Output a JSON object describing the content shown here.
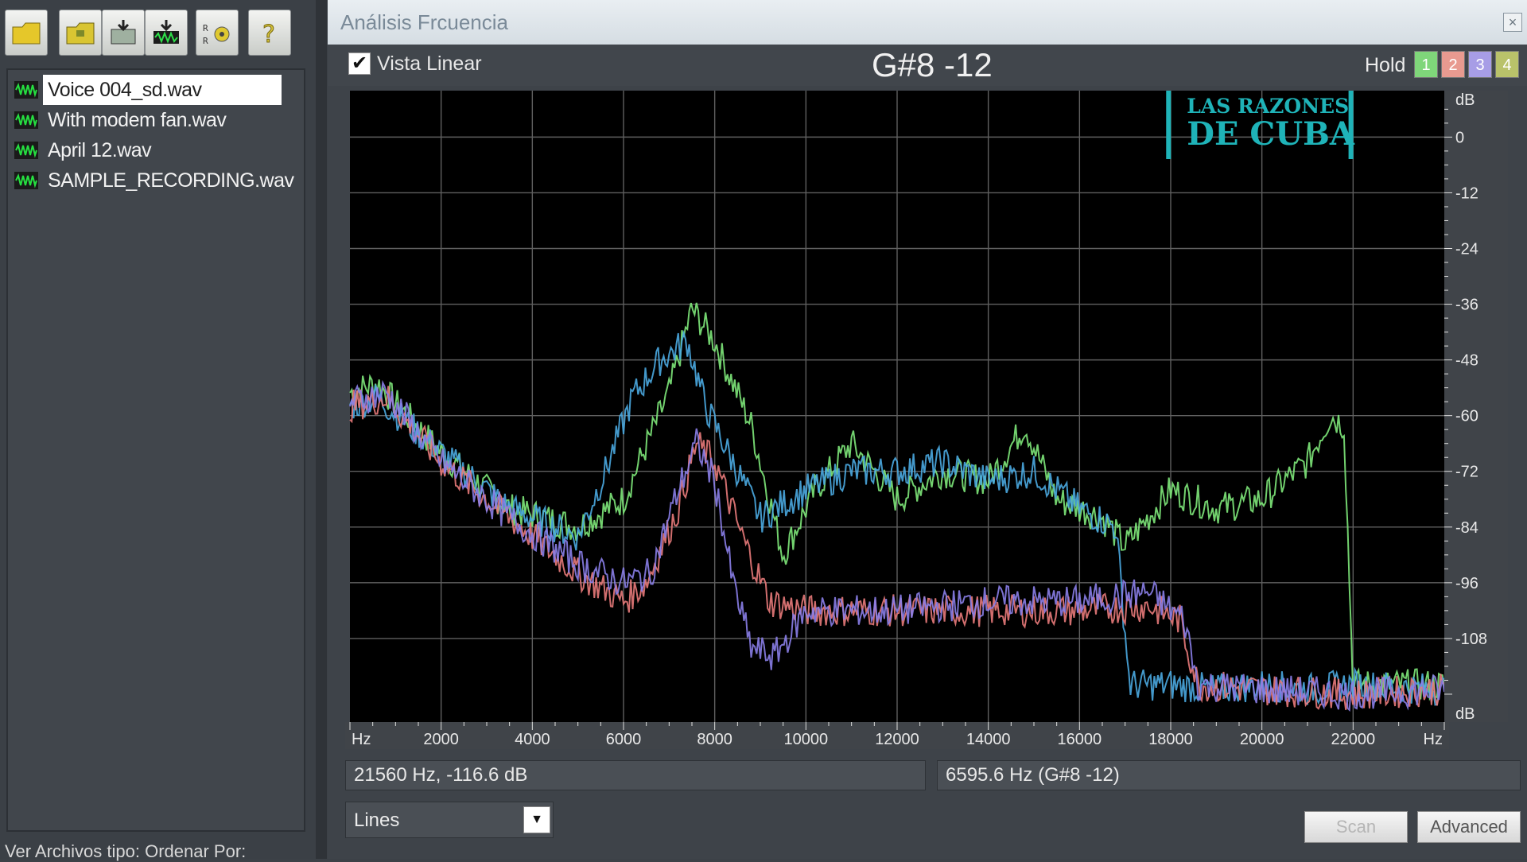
{
  "left_panel": {
    "files": [
      {
        "name": "Voice 004_sd.wav",
        "selected": true
      },
      {
        "name": "With modem fan.wav",
        "selected": false
      },
      {
        "name": "April 12.wav",
        "selected": false
      },
      {
        "name": "SAMPLE_RECORDING.wav",
        "selected": false
      }
    ],
    "bottom_label": "Ver Archivos tipo:  Ordenar Por:"
  },
  "window": {
    "title": "Análisis Frcuencia",
    "close_glyph": "×",
    "vista_linear_label": "Vista Linear",
    "vista_linear_checked": true,
    "note_display": "G#8 -12",
    "hold_label": "Hold",
    "hold_buttons": [
      {
        "label": "1",
        "color": "#7fd67a"
      },
      {
        "label": "2",
        "color": "#e89a90"
      },
      {
        "label": "3",
        "color": "#a79de6"
      },
      {
        "label": "4",
        "color": "#b9c26a"
      }
    ],
    "readout_left": "21560 Hz, -116.6 dB",
    "readout_right": "6595.6 Hz (G#8 -12)",
    "mode_select": "Lines",
    "scan_label": "Scan",
    "advanced_label": "Advanced"
  },
  "watermark": {
    "line1": "LAS RAZONES",
    "line2": "DE CUBA",
    "color": "#1fb3b8"
  },
  "chart_data": {
    "type": "line",
    "x_unit": "Hz",
    "y_unit": "dB",
    "xlim": [
      0,
      24000
    ],
    "ylim": [
      -126,
      10
    ],
    "x_ticks": [
      2000,
      4000,
      6000,
      8000,
      10000,
      12000,
      14000,
      16000,
      18000,
      20000,
      22000
    ],
    "y_ticks": [
      0,
      -12,
      -24,
      -36,
      -48,
      -60,
      -72,
      -84,
      -96,
      -108
    ],
    "grid": true,
    "series": [
      {
        "color": "#7ee87a",
        "x": [
          0,
          600,
          2000,
          3500,
          5000,
          6000,
          7000,
          7500,
          8000,
          8800,
          9500,
          10200,
          11000,
          12000,
          13000,
          14000,
          14800,
          15500,
          16500,
          17000,
          18000,
          19000,
          20000,
          21000,
          21500,
          21800,
          22000,
          24000
        ],
        "y": [
          -55,
          -53,
          -68,
          -80,
          -84,
          -78,
          -55,
          -37,
          -44,
          -62,
          -90,
          -76,
          -66,
          -78,
          -72,
          -74,
          -62,
          -78,
          -82,
          -88,
          -76,
          -80,
          -78,
          -70,
          -60,
          -62,
          -118,
          -118
        ]
      },
      {
        "color": "#4aa8e0",
        "x": [
          0,
          600,
          2000,
          3500,
          5000,
          5600,
          6200,
          6800,
          7400,
          7800,
          8500,
          9000,
          10000,
          11000,
          12000,
          13000,
          14000,
          15000,
          16000,
          16800,
          17100,
          18000,
          19000,
          20000,
          21000,
          22000,
          24000
        ],
        "y": [
          -58,
          -56,
          -68,
          -80,
          -86,
          -72,
          -56,
          -48,
          -44,
          -58,
          -72,
          -82,
          -76,
          -72,
          -72,
          -70,
          -74,
          -72,
          -80,
          -84,
          -118,
          -118,
          -119,
          -118,
          -119,
          -118,
          -119
        ]
      },
      {
        "color": "#e87a7a",
        "x": [
          0,
          800,
          2000,
          3500,
          5000,
          6000,
          6500,
          7200,
          7600,
          8000,
          8600,
          9200,
          10000,
          12000,
          14000,
          16000,
          17500,
          18200,
          18600,
          20000,
          22000,
          24000
        ],
        "y": [
          -58,
          -56,
          -70,
          -82,
          -94,
          -100,
          -96,
          -80,
          -66,
          -70,
          -86,
          -100,
          -102,
          -102,
          -102,
          -102,
          -101,
          -104,
          -118,
          -119,
          -120,
          -119
        ]
      },
      {
        "color": "#8a7ee8",
        "x": [
          0,
          800,
          2000,
          3500,
          5000,
          6000,
          6600,
          7200,
          7600,
          8000,
          8400,
          8800,
          9300,
          10000,
          12000,
          14000,
          16000,
          17500,
          18300,
          18600,
          20000,
          22000,
          24000
        ],
        "y": [
          -57,
          -55,
          -70,
          -82,
          -92,
          -96,
          -94,
          -76,
          -66,
          -74,
          -96,
          -110,
          -112,
          -102,
          -102,
          -100,
          -100,
          -98,
          -104,
          -118,
          -119,
          -120,
          -119
        ]
      }
    ]
  }
}
